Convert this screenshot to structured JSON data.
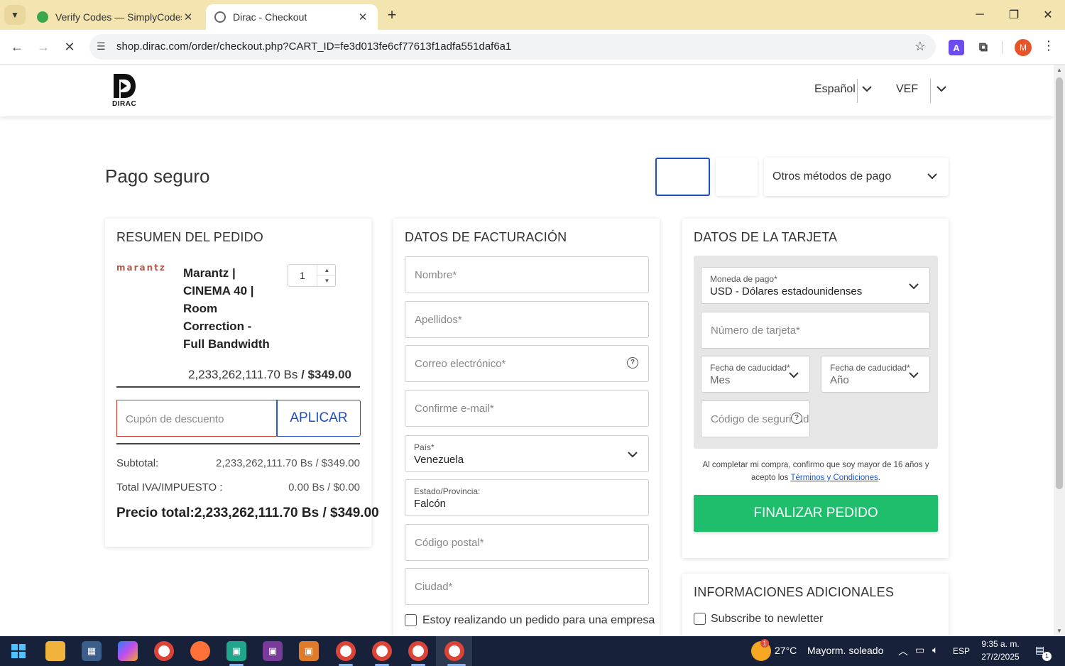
{
  "browser": {
    "tabs": [
      {
        "title": "Verify Codes — SimplyCodes",
        "active": false,
        "favicon_color": "#3aa84a"
      },
      {
        "title": "Dirac - Checkout",
        "active": true,
        "favicon_color": "#666666"
      }
    ],
    "url": "shop.dirac.com/order/checkout.php?CART_ID=fe3d013fe6cf77613f1adfa551daf6a1",
    "profile_initial": "M",
    "extension_letter": "A"
  },
  "header": {
    "logo_text": "DIRAC",
    "language": "Español",
    "currency": "VEF"
  },
  "checkout": {
    "title": "Pago seguro",
    "other_methods": "Otros métodos de pago"
  },
  "summary": {
    "heading": "RESUMEN DEL PEDIDO",
    "brand": "marantz",
    "product_name": "Marantz | CINEMA 40 | Room Correction - Full Bandwidth",
    "quantity": "1",
    "price_bs": "2,233,262,111.70 Bs",
    "price_usd": "/ $349.00",
    "coupon_placeholder": "Cupón de descuento",
    "apply_label": "APLICAR",
    "subtotal_label": "Subtotal:",
    "subtotal_value": "2,233,262,111.70 Bs / $349.00",
    "tax_label": "Total IVA/IMPUESTO :",
    "tax_value": "0.00 Bs / $0.00",
    "total_text": "Precio total:2,233,262,111.70 Bs / $349.00"
  },
  "billing": {
    "heading": "DATOS DE FACTURACIÓN",
    "first_name": "Nombre*",
    "last_name": "Apellidos*",
    "email": "Correo electrónico*",
    "confirm_email": "Confirme e-mail*",
    "country_label": "País*",
    "country_value": "Venezuela",
    "state_label": "Estado/Provincia:",
    "state_value": "Falcón",
    "postal_code": "Código postal*",
    "city": "Ciudad*",
    "company_checkbox": "Estoy realizando un pedido para una empresa"
  },
  "card": {
    "heading": "DATOS DE LA TARJETA",
    "currency_label": "Moneda de pago*",
    "currency_value": "USD - Dólares estadounidenses",
    "card_number": "Número de tarjeta*",
    "exp_label": "Fecha de caducidad*",
    "exp_month": "Mes",
    "exp_year": "Año",
    "cvv": "Código de seguridad*",
    "consent_prefix": "Al completar mi compra, confirmo que soy mayor de 16 años y acepto los",
    "terms_link": "Términos y Condiciones",
    "consent_suffix": ".",
    "submit": "FINALIZAR PEDIDO",
    "accent": "#1fbe6c"
  },
  "additional": {
    "heading": "INFORMACIONES ADICIONALES",
    "newsletter": "Subscribe to newletter"
  },
  "taskbar": {
    "weather_temp": "27°C",
    "weather_text": "Mayorm. soleado",
    "weather_badge": "1",
    "lang": "ESP",
    "time": "9:35 a. m.",
    "date": "27/2/2025",
    "notification_count": "1"
  }
}
